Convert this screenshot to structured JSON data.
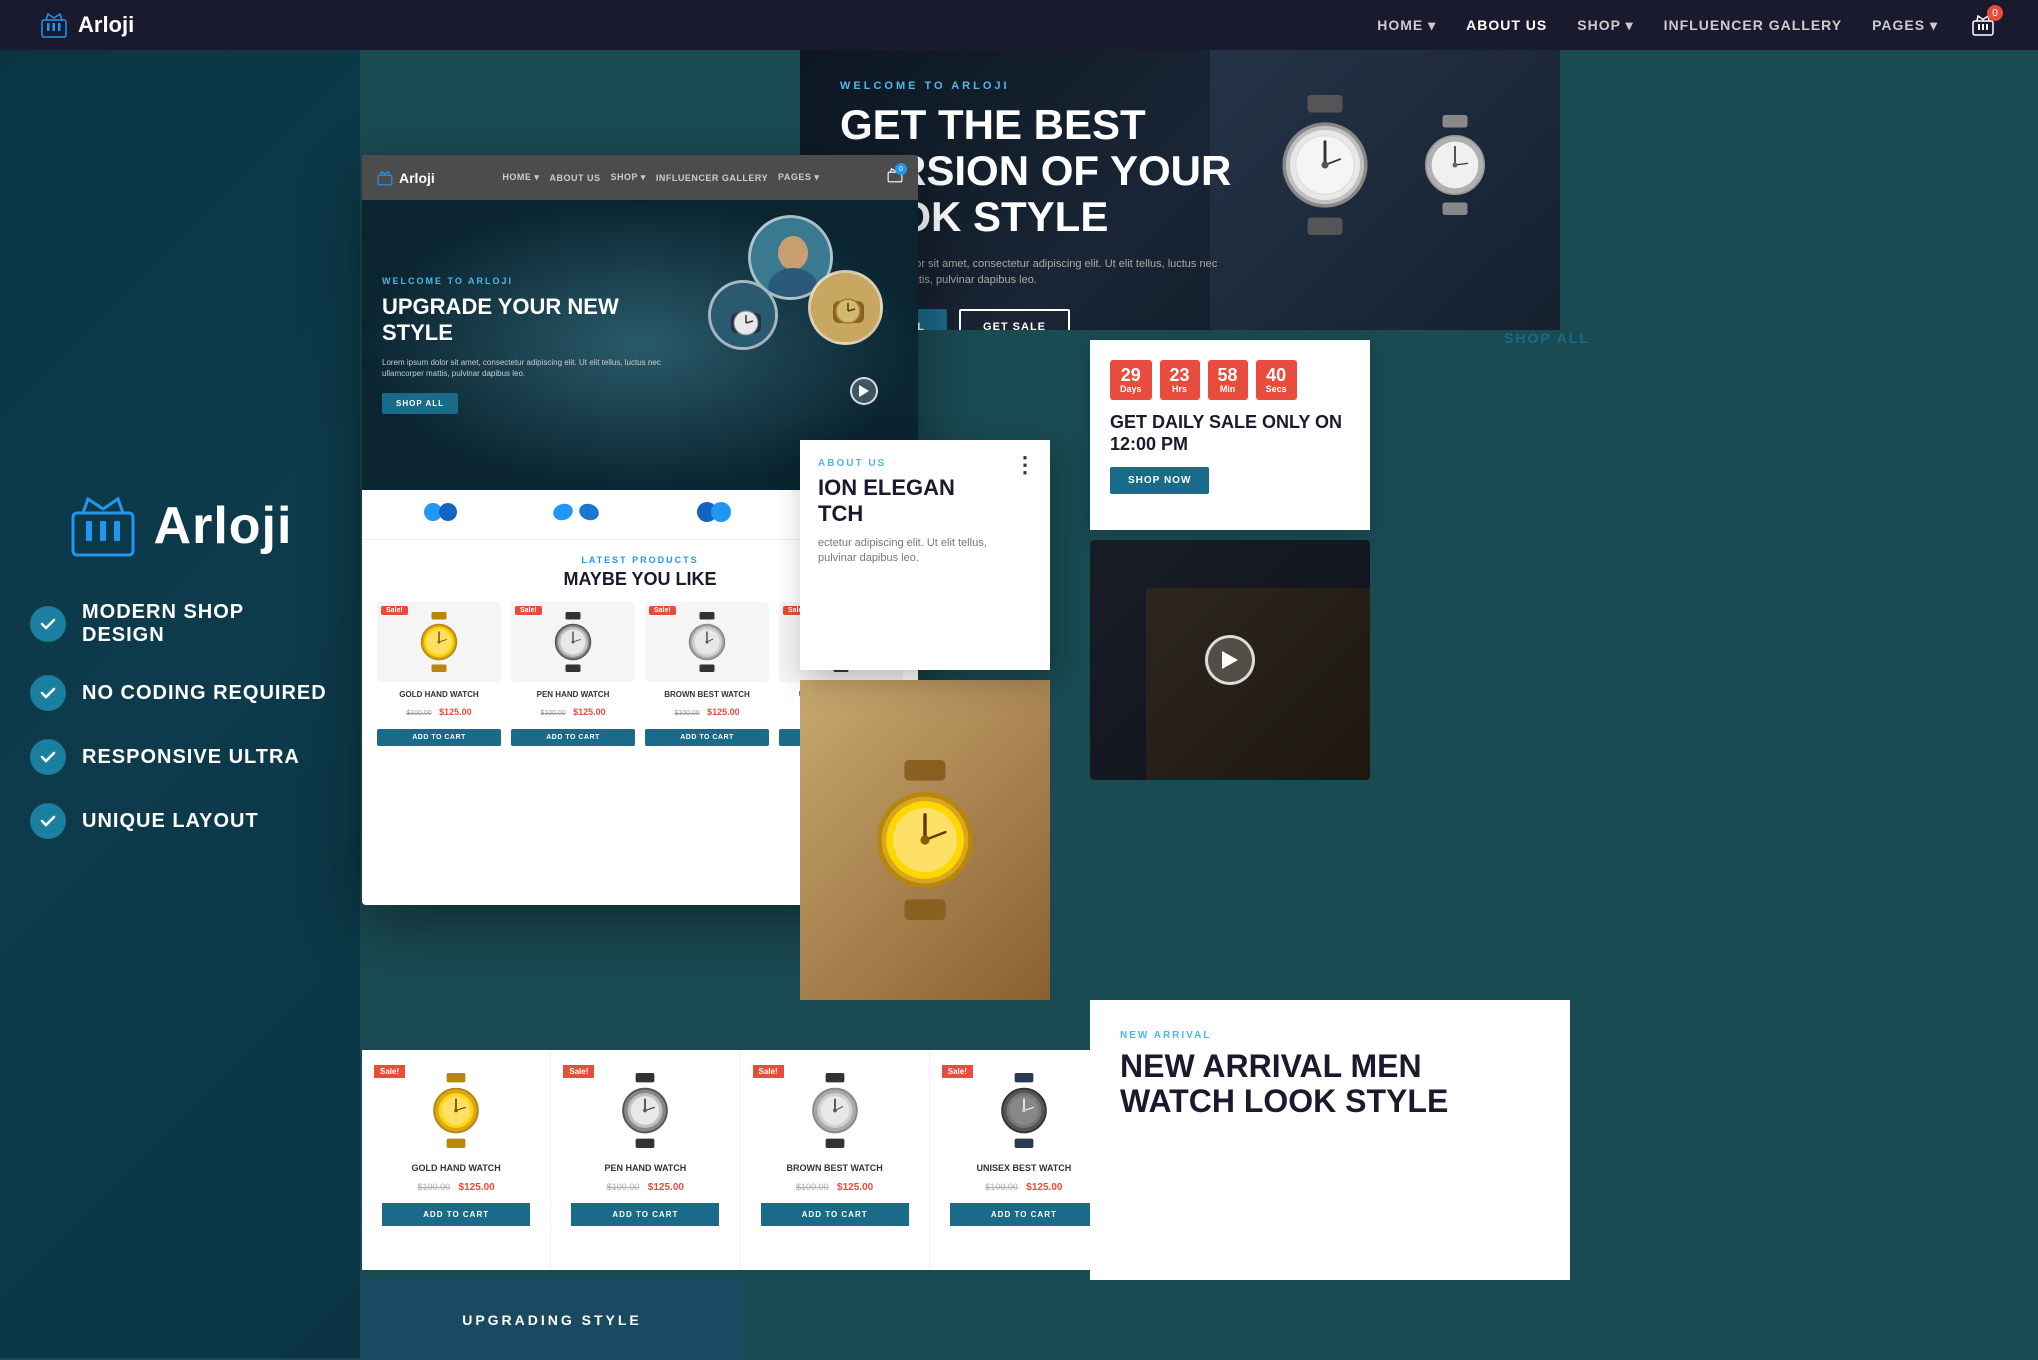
{
  "brand": {
    "name": "Arloji",
    "tagline": "WELCOME TO ARLOJI"
  },
  "top_nav": {
    "logo_text": "Arloji",
    "links": [
      "HOME",
      "ABOUT US",
      "SHOP",
      "INFLUENCER GALLERY",
      "PAGES"
    ],
    "cart_count": "0"
  },
  "left_panel": {
    "logo_text": "Arloji",
    "features": [
      "MODERN SHOP DESIGN",
      "NO CODING REQUIRED",
      "RESPONSIVE ULTRA",
      "UNIQUE LAYOUT"
    ]
  },
  "inner_nav": {
    "logo": "Arloji",
    "links": [
      "HOME",
      "ABOUT US",
      "SHOP",
      "INFLUENCER GALLERY",
      "PAGES"
    ],
    "cart_count": "0"
  },
  "hero": {
    "label": "WELCOME TO ARLOJI",
    "title": "UPGRADE YOUR NEW STYLE",
    "description": "Lorem ipsum dolor sit amet, consectetur adipiscing elit. Ut elit tellus, luctus nec ullamcorper mattis, pulvinar dapibus leo.",
    "btn_text": "SHOP ALL"
  },
  "hero_dark": {
    "label": "WELCOME TO ARLOJI",
    "title": "GET THE BEST VERSION OF YOUR LOOK STYLE",
    "description": "orem ipsum dolor sit amet, consectetur adipiscing elit. Ut elit tellus, luctus nec ullamcorper mattis, pulvinar dapibus leo.",
    "btn_shop": "SHOP ALL",
    "btn_sale": "GET SALE"
  },
  "about_section": {
    "label": "ABOUT US",
    "title_line1": "ION ELEGAN",
    "title_line2": "TCH",
    "description": "ectetur adipiscing elit. Ut elit tellus,\npulvinar dapibus leo."
  },
  "countdown": {
    "days_num": "29",
    "days_label": "Days",
    "hrs_num": "23",
    "hrs_label": "Hrs",
    "min_num": "58",
    "min_label": "Min",
    "sec_num": "40",
    "sec_label": "Secs",
    "title": "GET DAILY SALE ONLY ON 12:00 PM",
    "btn": "SHOP NOW"
  },
  "products": {
    "section_label": "LATEST PRODUCTS",
    "section_title": "MAYBE YOU LIKE",
    "items": [
      {
        "name": "GOLD HAND WATCH",
        "old_price": "$100.00",
        "new_price": "$125.00",
        "btn": "ADD TO CART",
        "sale": "Sale!"
      },
      {
        "name": "PEN HAND WATCH",
        "old_price": "$100.00",
        "new_price": "$125.00",
        "btn": "ADD TO CART",
        "sale": "Sale!"
      },
      {
        "name": "BROWN BEST WATCH",
        "old_price": "$100.00",
        "new_price": "$125.00",
        "btn": "ADD TO CART",
        "sale": "Sale!"
      },
      {
        "name": "UNISEX BEST WATCH",
        "old_price": "$100.00",
        "new_price": "$125.00",
        "btn": "ADD TO CART",
        "sale": "Sale!"
      }
    ]
  },
  "new_arrival": {
    "label": "NEW ARRIVAL",
    "title": "NEW ARRIVAL MEN WATCH LOOK STYLE"
  },
  "upgrading": {
    "label": "UPGRADING STYLE"
  },
  "shop_all_link": "ShOp ALl",
  "brands": [
    "✦",
    "✦✦",
    "⬤⬤",
    "✿"
  ]
}
